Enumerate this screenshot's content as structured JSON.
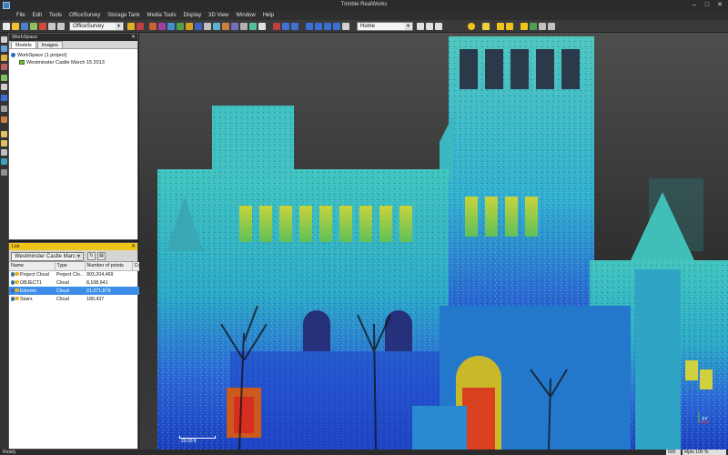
{
  "window": {
    "title": "Trimble RealWorks"
  },
  "menu": [
    "File",
    "Edit",
    "Tools",
    "OfficeSurvey",
    "Storage Tank",
    "Media Tools",
    "Display",
    "3D View",
    "Window",
    "Help"
  ],
  "toolbar": {
    "module_combo": "OfficeSurvey",
    "view_combo": "Home"
  },
  "workspace": {
    "title": "WorkSpace",
    "tabs": [
      "Models",
      "Images"
    ],
    "tree_root": "WorkSpace  (1 project)",
    "project": "Westminster Castle March 15 2013"
  },
  "list": {
    "title": "List",
    "combo": "Westminster Castle Marc",
    "columns": [
      "Name",
      "Type",
      "Number of points",
      "Co"
    ],
    "rows": [
      {
        "name": "Project Cloud",
        "type": "Project Clo...",
        "points": "903,204,469",
        "selected": false
      },
      {
        "name": "OBJECT1",
        "type": "Cloud",
        "points": "8,108,641",
        "selected": false
      },
      {
        "name": "Exterior",
        "type": "Cloud",
        "points": "21,971,879",
        "selected": true
      },
      {
        "name": "Stairs",
        "type": "Cloud",
        "points": "180,437",
        "selected": false
      }
    ]
  },
  "viewport": {
    "scale_label": "20.00 ft",
    "axis_label": "XY"
  },
  "status": {
    "text": "Ready",
    "field1": "500",
    "field2": "Mpts 100 %"
  },
  "colors": {
    "list_header": "#f0c419",
    "selection": "#3d8ee8",
    "cloud_cyan": "#2fb8c9",
    "cloud_blue": "#1f4fd6"
  }
}
